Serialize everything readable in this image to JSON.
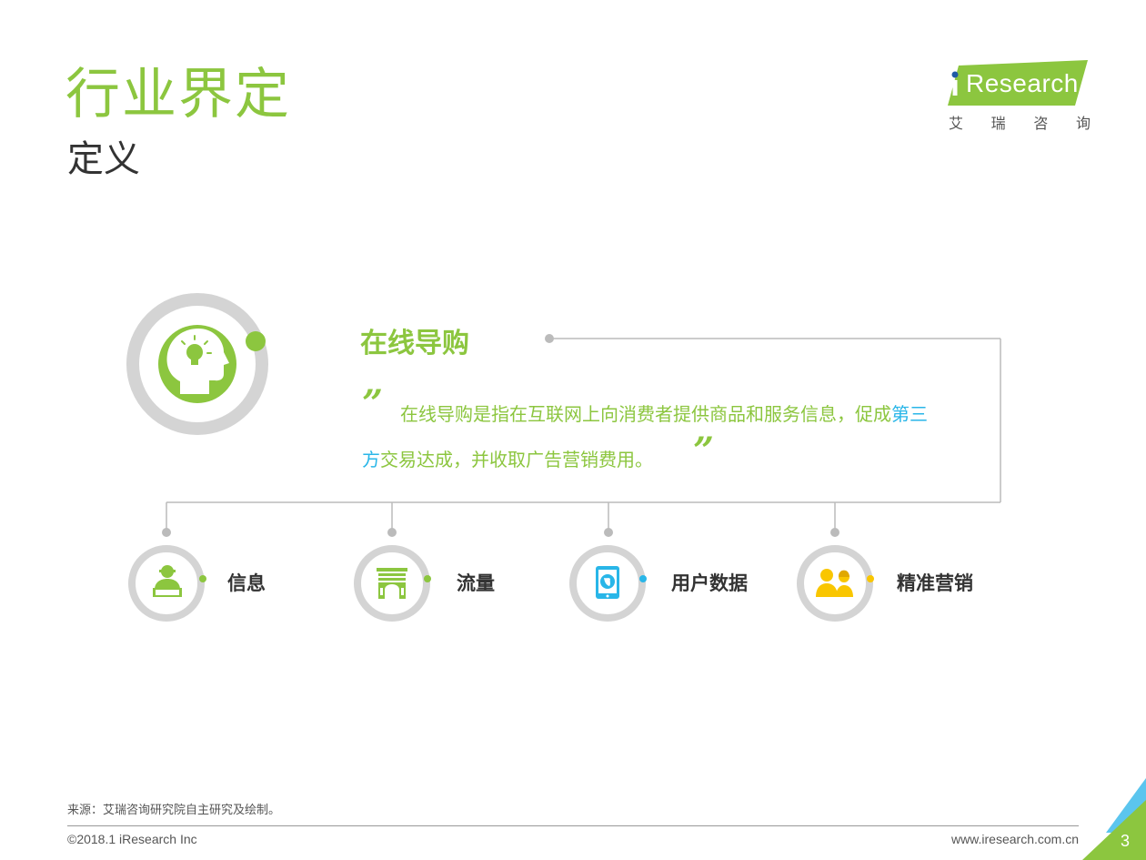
{
  "header": {
    "title": "行业界定",
    "subtitle": "定义"
  },
  "logo": {
    "brand": "Research",
    "cn_chars": [
      "艾",
      "瑞",
      "咨",
      "询"
    ]
  },
  "definition": {
    "heading": "在线导购",
    "quote_open": "”",
    "quote_close": "”",
    "line1_a": "在线导购是指在互联网上向消费者提供商品和服务信息，促成",
    "line1_b": "第三",
    "line2_a": "方",
    "line2_b": "交易达成，并收取广告营销费用。"
  },
  "items": [
    {
      "label": "信息",
      "icon": "person-laptop-icon"
    },
    {
      "label": "流量",
      "icon": "arch-gate-icon"
    },
    {
      "label": "用户数据",
      "icon": "tablet-globe-icon"
    },
    {
      "label": "精准营销",
      "icon": "users-icon"
    }
  ],
  "colors": {
    "green": "#8cc63f",
    "blue": "#29b6e8",
    "yellow": "#f9c600",
    "ring": "#d4d4d4"
  },
  "footer": {
    "source": "来源：艾瑞咨询研究院自主研究及绘制。",
    "copyright": "©2018.1 iResearch Inc",
    "website": "www.iresearch.com.cn",
    "page": "3"
  }
}
